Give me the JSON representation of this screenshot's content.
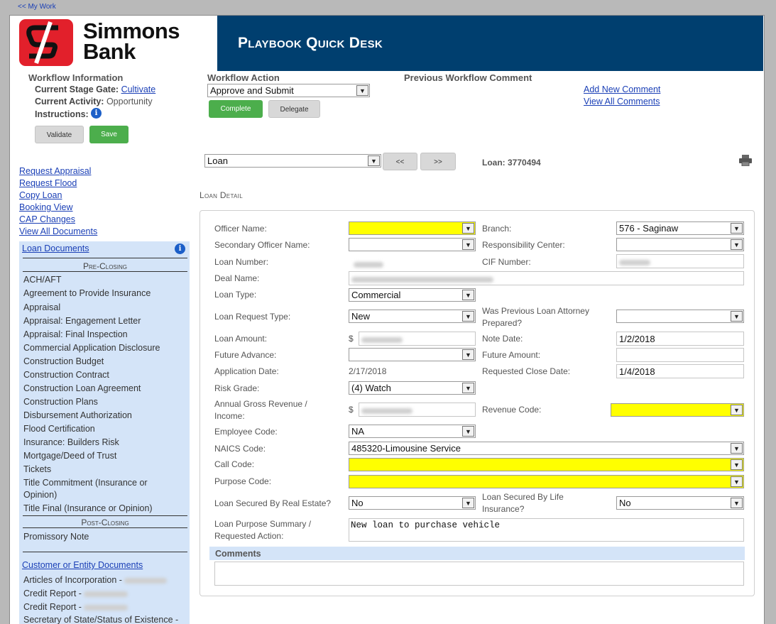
{
  "nav": {
    "my_work": "<< My Work"
  },
  "brand": {
    "logo_line1": "Simmons",
    "logo_line2": "Bank",
    "title": "Playbook Quick Desk",
    "color_banner": "#003f6f",
    "color_logo": "#e2202b"
  },
  "workflow_info": {
    "heading": "Workflow Information",
    "stage_label": "Current Stage Gate:",
    "stage_value": "Cultivate",
    "activity_label": "Current Activity:",
    "activity_value": "Opportunity",
    "instructions_label": "Instructions:",
    "validate": "Validate",
    "save": "Save"
  },
  "workflow_action": {
    "heading": "Workflow Action",
    "selected": "Approve and Submit",
    "complete": "Complete",
    "delegate": "Delegate"
  },
  "previous_comment": {
    "heading": "Previous Workflow Comment",
    "add": "Add New Comment",
    "view_all": "View All Comments"
  },
  "actions": [
    "Request Appraisal",
    "Request Flood",
    "Copy Loan",
    "Booking View",
    "CAP Changes",
    "View All Documents"
  ],
  "loan_nav": {
    "selected": "Loan",
    "prev": "<<",
    "next": ">>",
    "loan_label": "Loan: 3770494"
  },
  "section_title": "Loan Detail",
  "loan_documents": {
    "title": "Loan Documents",
    "pre_closing": "Pre-Closing",
    "pre_items": [
      "ACH/AFT",
      "Agreement to Provide Insurance",
      "Appraisal",
      "Appraisal: Engagement Letter",
      "Appraisal: Final Inspection",
      "Commercial Application Disclosure",
      "Construction Budget",
      "Construction Contract",
      "Construction Loan Agreement",
      "Construction Plans",
      "Disbursement Authorization",
      "Flood Certification",
      "Insurance: Builders Risk",
      "Mortgage/Deed of Trust",
      "Tickets",
      "Title Commitment (Insurance or",
      "Opinion)",
      "Title Final (Insurance or Opinion)"
    ],
    "post_closing": "Post-Closing",
    "post_items": [
      "Promissory Note"
    ]
  },
  "entity_documents": {
    "title": "Customer or Entity Documents",
    "items": [
      "Articles of Incorporation -",
      "Credit Report -",
      "Credit Report -",
      "Secretary of State/Status of Existence -"
    ]
  },
  "form": {
    "officer_name": "Officer Name:",
    "branch": "Branch:",
    "branch_value": "576 - Saginaw",
    "secondary_officer": "Secondary Officer Name:",
    "responsibility_center": "Responsibility Center:",
    "loan_number": "Loan Number:",
    "cif_number": "CIF Number:",
    "deal_name": "Deal Name:",
    "loan_type": "Loan Type:",
    "loan_type_value": "Commercial",
    "loan_request_type": "Loan Request Type:",
    "loan_request_type_value": "New",
    "prev_attorney_1": "Was Previous Loan Attorney",
    "prev_attorney_2": "Prepared?",
    "loan_amount": "Loan Amount:",
    "currency": "$",
    "note_date": "Note Date:",
    "note_date_value": "1/2/2018",
    "future_advance": "Future Advance:",
    "future_amount": "Future Amount:",
    "application_date": "Application Date:",
    "application_date_value": "2/17/2018",
    "requested_close": "Requested Close Date:",
    "requested_close_value": "1/4/2018",
    "risk_grade": "Risk Grade:",
    "risk_grade_value": "(4) Watch",
    "revenue_1": "Annual Gross Revenue /",
    "revenue_2": "Income:",
    "revenue_code": "Revenue Code:",
    "employee_code": "Employee Code:",
    "employee_code_value": "NA",
    "naics_code": "NAICS Code:",
    "naics_code_value": "485320-Limousine Service",
    "call_code": "Call Code:",
    "purpose_code": "Purpose Code:",
    "real_estate": "Loan Secured By Real Estate?",
    "real_estate_value": "No",
    "life_ins_1": "Loan Secured By Life",
    "life_ins_2": "Insurance?",
    "life_ins_value": "No",
    "summary_1": "Loan Purpose Summary /",
    "summary_2": "Requested Action:",
    "summary_value": "New loan to purchase vehicle",
    "comments": "Comments"
  }
}
